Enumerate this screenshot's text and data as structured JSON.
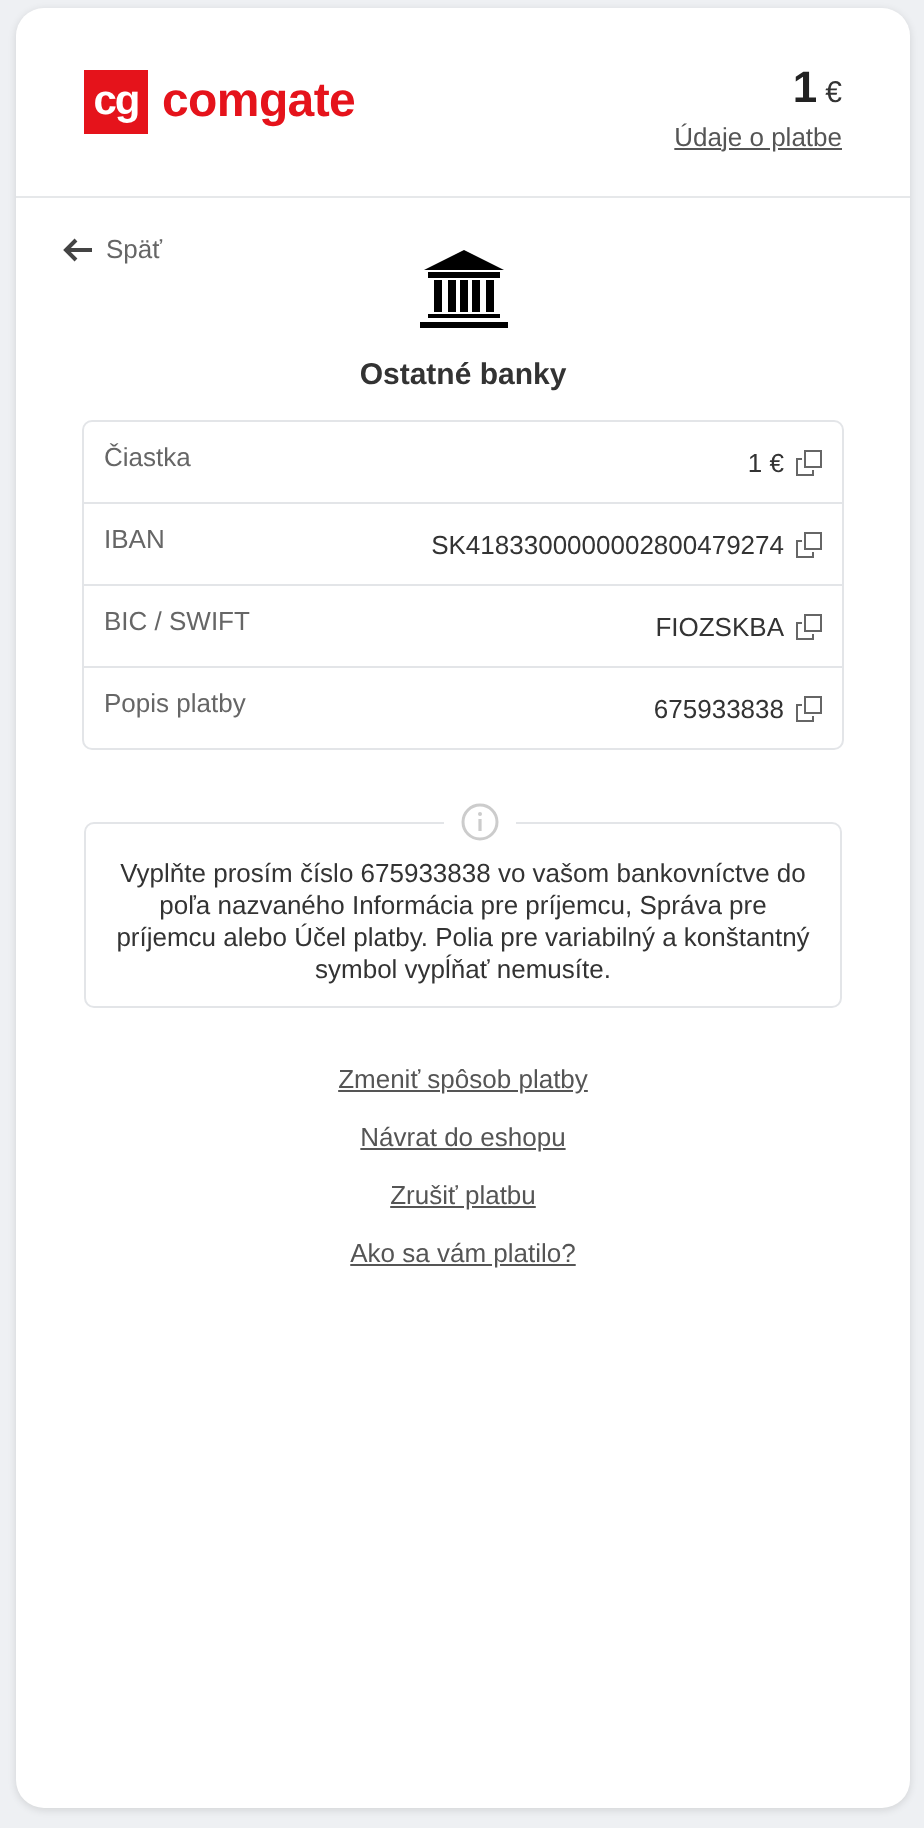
{
  "header": {
    "logo_mark": "cg",
    "logo_text": "comgate",
    "amount": "1",
    "currency": "€",
    "details_link": "Údaje o platbe"
  },
  "back": {
    "label": "Späť"
  },
  "method": {
    "title": "Ostatné banky"
  },
  "details": [
    {
      "label": "Čiastka",
      "value": "1 €"
    },
    {
      "label": "IBAN",
      "value": "SK4183300000002800479274"
    },
    {
      "label": "BIC / SWIFT",
      "value": "FIOZSKBA"
    },
    {
      "label": "Popis platby",
      "value": "675933838"
    }
  ],
  "info": {
    "text": "Vyplňte prosím číslo 675933838 vo vašom bankovníctve do poľa nazvaného Informácia pre príjemcu, Správa pre príjemcu alebo Účel platby. Polia pre variabilný a konštantný symbol vypĺňať nemusíte."
  },
  "links": [
    "Zmeniť spôsob platby",
    "Návrat do eshopu",
    "Zrušiť platbu",
    "Ako sa vám platilo?"
  ]
}
